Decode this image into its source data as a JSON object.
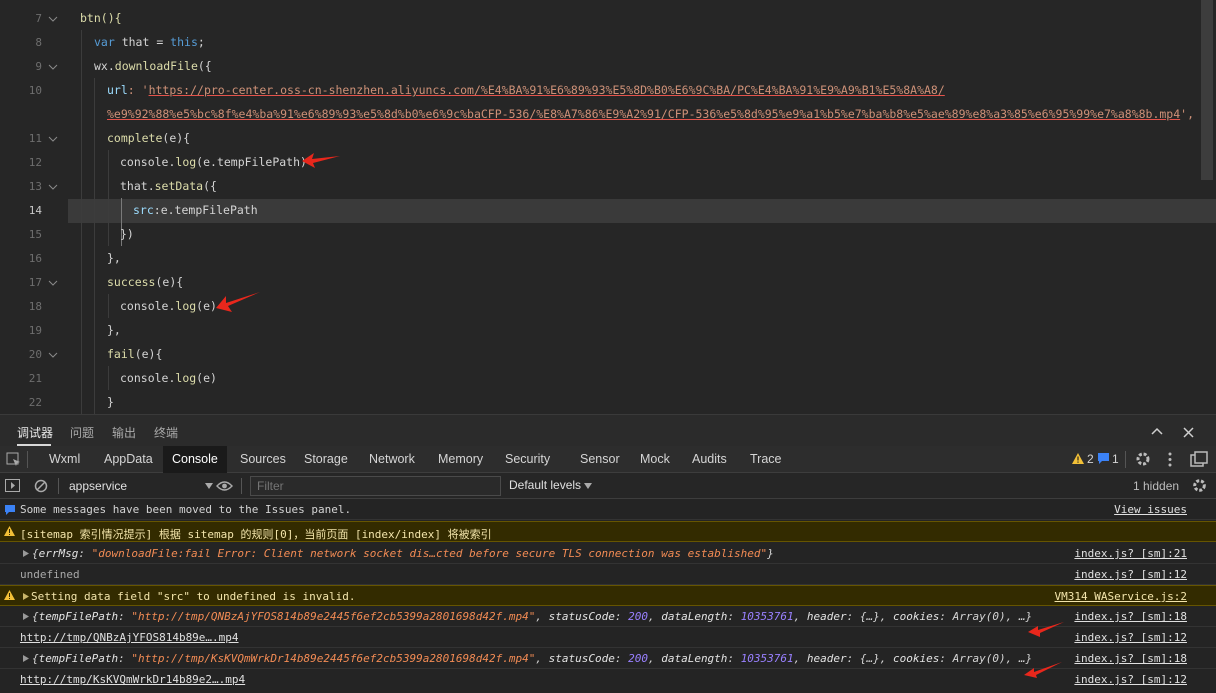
{
  "editor": {
    "line_numbers": [
      "7",
      "8",
      "9",
      "10",
      "",
      "11",
      "12",
      "13",
      "14",
      "15",
      "16",
      "17",
      "18",
      "19",
      "20",
      "21",
      "22"
    ],
    "lines": {
      "l7": "btn(){",
      "l8a": "var",
      "l8b": " that = ",
      "l8c": "this",
      "l8d": ";",
      "l9a": "wx.",
      "l9b": "downloadFile",
      "l9c": "({",
      "l10a": "url",
      "l10b": ": '",
      "l10url1": "https://pro-center.oss-cn-shenzhen.aliyuncs.com/%E4%BA%91%E6%89%93%E5%8D%B0%E6%9C%BA/PC%E4%BA%91%E9%A9%B1%E5%8A%A8/",
      "l10url2": "%e9%92%88%e5%bc%8f%e4%ba%91%e6%89%93%e5%8d%b0%e6%9c%baCFP-536/%E8%A7%86%E9%A2%91/CFP-536%e5%8d%95%e9%a1%b5%e7%ba%b8%e5%ae%89%e8%a3%85%e6%95%99%e7%a8%8b.mp4",
      "l10end": "',",
      "l11a": "complete",
      "l11b": "(e){",
      "l12a": "console.",
      "l12b": "log",
      "l12c": "(e.tempFilePath)",
      "l13a": "that.",
      "l13b": "setData",
      "l13c": "({",
      "l14a": "src",
      "l14b": ":e.tempFilePath",
      "l15": "})",
      "l16": "},",
      "l17a": "success",
      "l17b": "(e){",
      "l18a": "console.",
      "l18b": "log",
      "l18c": "(e)",
      "l19": "},",
      "l20a": "fail",
      "l20b": "(e){",
      "l21a": "console.",
      "l21b": "log",
      "l21c": "(e)",
      "l22": "}"
    }
  },
  "panel_tabs": [
    "调试器",
    "问题",
    "输出",
    "终端"
  ],
  "devtools_tabs": [
    "Wxml",
    "AppData",
    "Console",
    "Sources",
    "Storage",
    "Network",
    "Memory",
    "Security",
    "Sensor",
    "Mock",
    "Audits",
    "Trace"
  ],
  "active_tab": "Console",
  "badges": {
    "warnings": "2",
    "info": "1"
  },
  "filterbar": {
    "context": "appservice",
    "filter_placeholder": "Filter",
    "levels": "Default levels",
    "hidden": "1 hidden"
  },
  "console": {
    "r1_msg": "Some messages have been moved to the Issues panel.",
    "r1_link": "View issues",
    "r2_msg": "[sitemap 索引情况提示] 根据 sitemap 的规则[0]，当前页面 [index/index] 将被索引",
    "r3_k": "errMsg",
    "r3_v": "\"downloadFile:fail Error: Client network socket dis…cted before secure TLS connection was established\"",
    "r3_src": "index.js? [sm]:21",
    "r4_msg": "undefined",
    "r4_src": "index.js? [sm]:12",
    "r5_msg": "Setting data field \"src\" to undefined is invalid.",
    "r5_src": "VM314 WAService.js:2",
    "r6_path": "\"http://tmp/QNBzAjYFOS814b89e2445f6ef2cb5399a2801698d42f.mp4\"",
    "r6_status": "200",
    "r6_len": "10353761",
    "r6_src": "index.js? [sm]:18",
    "r7_msg": "http://tmp/QNBzAjYFOS814b89e….mp4",
    "r7_src": "index.js? [sm]:12",
    "r8_path": "\"http://tmp/KsKVQmWrkDr14b89e2445f6ef2cb5399a2801698d42f.mp4\"",
    "r8_status": "200",
    "r8_len": "10353761",
    "r8_src": "index.js? [sm]:18",
    "r9_msg": "http://tmp/KsKVQmWrkDr14b89e2….mp4",
    "r9_src": "index.js? [sm]:12",
    "k_tempFilePath": "tempFilePath",
    "k_statusCode": "statusCode",
    "k_dataLength": "dataLength",
    "k_header": "header",
    "k_cookies": "cookies",
    "header_val": "{…}",
    "cookies_val": "Array(0), …}"
  },
  "colors": {
    "accent_warning": "#f2c037",
    "arrow": "#e8271c"
  }
}
